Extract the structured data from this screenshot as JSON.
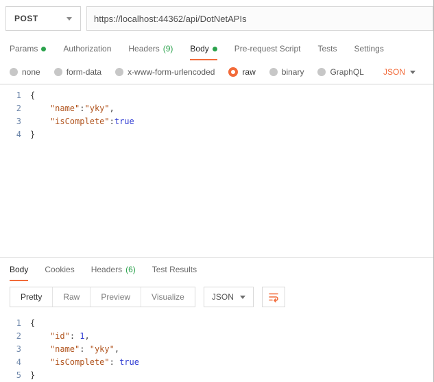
{
  "colors": {
    "accent": "#F26B3A",
    "green": "#2BA24C"
  },
  "request": {
    "method": "POST",
    "url": "https://localhost:44362/api/DotNetAPIs",
    "tabs": [
      {
        "label": "Params",
        "dot": true
      },
      {
        "label": "Authorization"
      },
      {
        "label": "Headers",
        "count": "(9)"
      },
      {
        "label": "Body",
        "dot": true,
        "active": true
      },
      {
        "label": "Pre-request Script"
      },
      {
        "label": "Tests"
      },
      {
        "label": "Settings"
      }
    ],
    "body_types": [
      "none",
      "form-data",
      "x-www-form-urlencoded",
      "raw",
      "binary",
      "GraphQL"
    ],
    "selected_body_type": "raw",
    "language": "JSON",
    "code_lines": [
      [
        [
          "p",
          "{"
        ]
      ],
      [
        [
          "p",
          "    "
        ],
        [
          "k",
          "\"name\""
        ],
        [
          "p",
          ":"
        ],
        [
          "s",
          "\"yky\""
        ],
        [
          "p",
          ","
        ]
      ],
      [
        [
          "p",
          "    "
        ],
        [
          "k",
          "\"isComplete\""
        ],
        [
          "p",
          ":"
        ],
        [
          "b",
          "true"
        ]
      ],
      [
        [
          "p",
          "}"
        ]
      ]
    ]
  },
  "response": {
    "tabs": [
      {
        "label": "Body",
        "active": true
      },
      {
        "label": "Cookies"
      },
      {
        "label": "Headers",
        "count": "(6)"
      },
      {
        "label": "Test Results"
      }
    ],
    "views": [
      "Pretty",
      "Raw",
      "Preview",
      "Visualize"
    ],
    "active_view": "Pretty",
    "language": "JSON",
    "code_lines": [
      [
        [
          "p",
          "{"
        ]
      ],
      [
        [
          "p",
          "    "
        ],
        [
          "k",
          "\"id\""
        ],
        [
          "p",
          ": "
        ],
        [
          "n",
          "1"
        ],
        [
          "p",
          ","
        ]
      ],
      [
        [
          "p",
          "    "
        ],
        [
          "k",
          "\"name\""
        ],
        [
          "p",
          ": "
        ],
        [
          "s",
          "\"yky\""
        ],
        [
          "p",
          ","
        ]
      ],
      [
        [
          "p",
          "    "
        ],
        [
          "k",
          "\"isComplete\""
        ],
        [
          "p",
          ": "
        ],
        [
          "b",
          "true"
        ]
      ],
      [
        [
          "p",
          "}"
        ]
      ]
    ]
  }
}
